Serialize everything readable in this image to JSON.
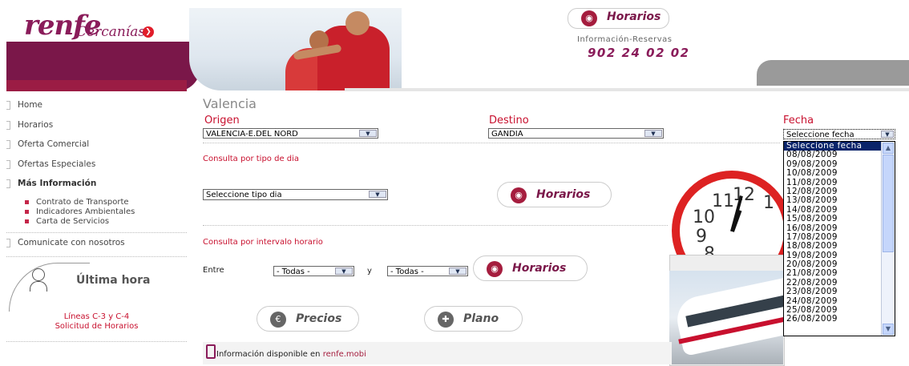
{
  "header": {
    "brand": "renfe",
    "brand_sub": "Cercanías",
    "horarios_label": "Horarios",
    "info_label": "Información-Reservas",
    "phone": "902 24 02 02"
  },
  "nav": {
    "items": [
      {
        "label": "Home"
      },
      {
        "label": "Horarios"
      },
      {
        "label": "Oferta Comercial"
      },
      {
        "label": "Ofertas Especiales"
      },
      {
        "label": "Más Información"
      }
    ],
    "subitems": [
      "Contrato de Transporte",
      "Indicadores Ambientales",
      "Carta de Servicios"
    ],
    "contact": "Comunicate con nosotros",
    "ultima_hora": "Última hora",
    "lineas": "Líneas C-3 y C-4",
    "solicitud": "Solicitud de Horarios"
  },
  "main": {
    "city": "Valencia",
    "origen_label": "Origen",
    "origen_value": "VALENCIA-E.DEL NORD",
    "destino_label": "Destino",
    "destino_value": "GANDIA",
    "fecha_label": "Fecha",
    "fecha_value": "Seleccione fecha",
    "tipo_title": "Consulta por tipo de dia",
    "tipo_value": "Seleccione tipo dia",
    "horarios_btn": "Horarios",
    "intervalo_title": "Consulta por intervalo horario",
    "entre_label": "Entre",
    "todas_1": "- Todas -",
    "y_label": "y",
    "todas_2": "- Todas -",
    "horarios_btn2": "Horarios",
    "precios_btn": "Precios",
    "plano_btn": "Plano",
    "mobi_text": "Información disponible en",
    "mobi_link": "renfe.mobi"
  },
  "date_options": [
    "Seleccione fecha",
    "08/08/2009",
    "09/08/2009",
    "10/08/2009",
    "11/08/2009",
    "12/08/2009",
    "13/08/2009",
    "14/08/2009",
    "15/08/2009",
    "16/08/2009",
    "17/08/2009",
    "18/08/2009",
    "19/08/2009",
    "20/08/2009",
    "21/08/2009",
    "22/08/2009",
    "23/08/2009",
    "24/08/2009",
    "25/08/2009",
    "26/08/2009"
  ],
  "clock_numbers": [
    "11",
    "12",
    "1",
    "10",
    "9",
    "8"
  ],
  "colors": {
    "brand": "#8a1c5a",
    "accent_red": "#c8102e",
    "select_highlight": "#0a246a"
  }
}
